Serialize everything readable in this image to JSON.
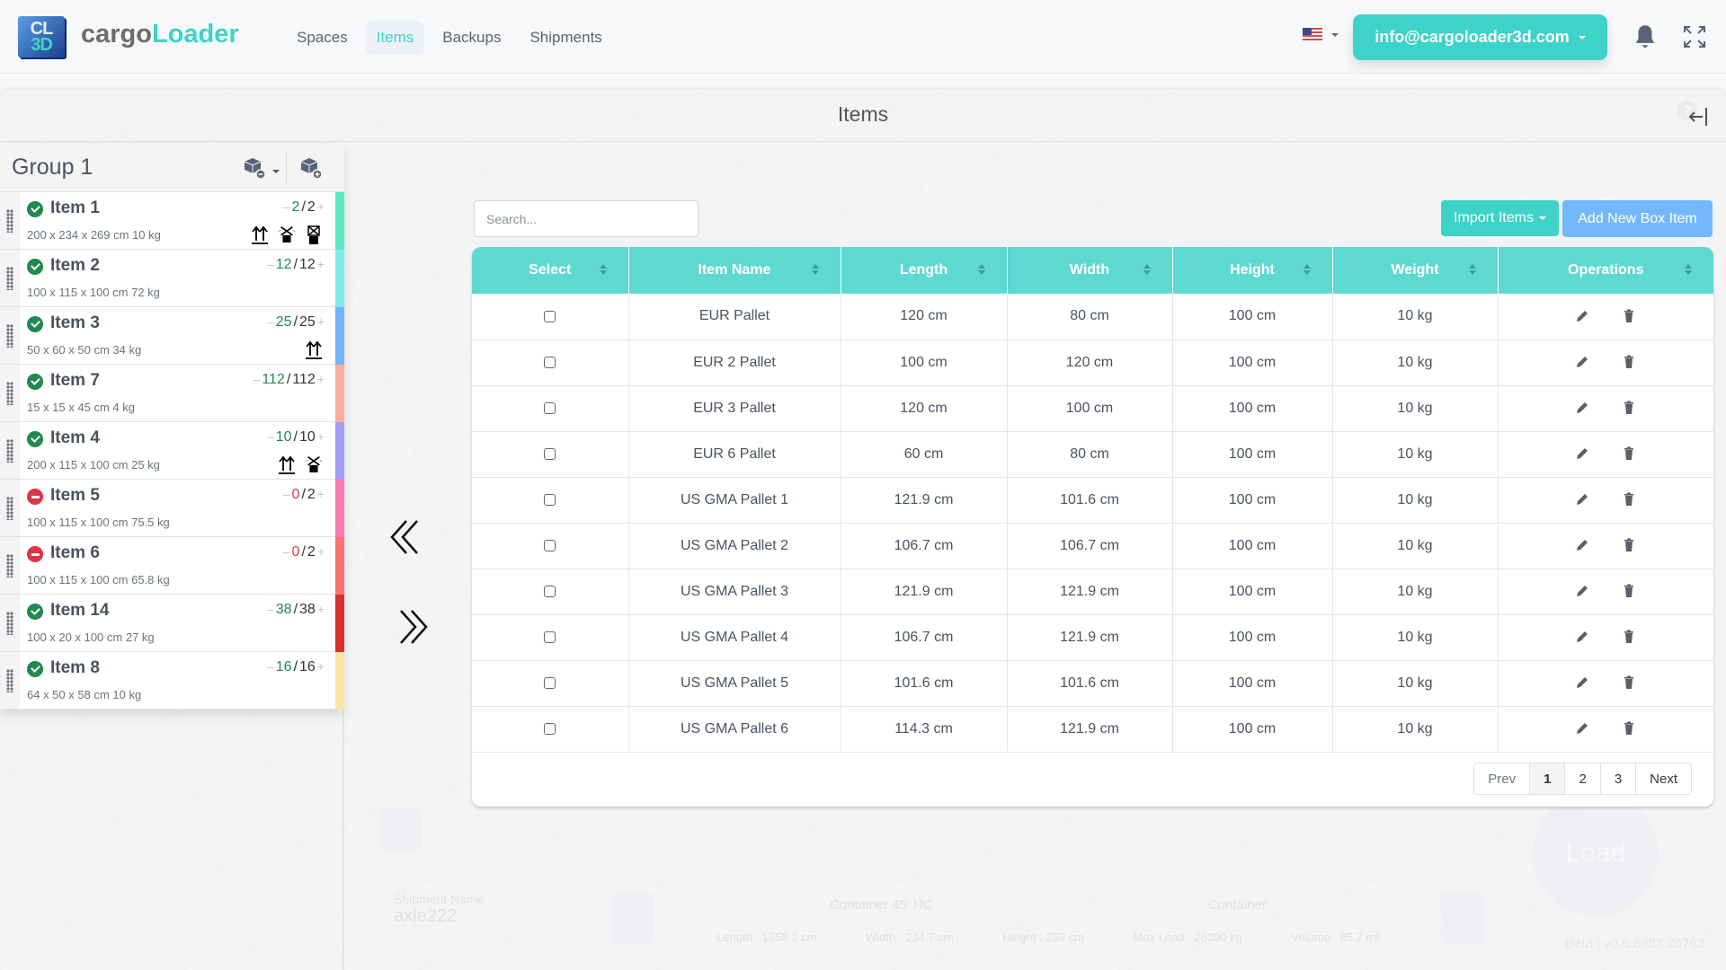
{
  "app": {
    "logo_line1": "CL",
    "logo_line2": "3D",
    "brand_part1": "cargo",
    "brand_part2": "Loader",
    "accent_color": "#3dd3c8"
  },
  "nav": {
    "items": [
      {
        "label": "Spaces",
        "active": false
      },
      {
        "label": "Items",
        "active": true
      },
      {
        "label": "Backups",
        "active": false
      },
      {
        "label": "Shipments",
        "active": false
      }
    ],
    "language_flag": "us-flag-icon",
    "account_email": "info@cargoloader3d.com",
    "notification_icon": "bell-icon",
    "fullscreen_icon": "fullscreen-icon"
  },
  "page": {
    "title": "Items",
    "help_glyph": "?",
    "collapse_icon": "collapse-left-icon"
  },
  "group": {
    "title": "Group 1",
    "remove_icon": "cube-minus-icon",
    "add_icon": "cube-plus-icon",
    "items": [
      {
        "name": "Item 1",
        "dims": "200 x 234 x 269 cm 10 kg",
        "loaded": "2",
        "total": "2",
        "status": "ok",
        "color": "#5ae8c4",
        "flags": [
          "this-side-up-icon",
          "no-stack-icon",
          "no-top-load-icon"
        ]
      },
      {
        "name": "Item 2",
        "dims": "100 x 115 x 100 cm 72 kg",
        "loaded": "12",
        "total": "12",
        "status": "ok",
        "color": "#7eeaea",
        "flags": []
      },
      {
        "name": "Item 3",
        "dims": "50 x 60 x 50 cm 34 kg",
        "loaded": "25",
        "total": "25",
        "status": "ok",
        "color": "#72b4fb",
        "flags": [
          "this-side-up-icon"
        ]
      },
      {
        "name": "Item 7",
        "dims": "15 x 15 x 45 cm 4 kg",
        "loaded": "112",
        "total": "112",
        "status": "ok",
        "color": "#f7b09c",
        "flags": []
      },
      {
        "name": "Item 4",
        "dims": "200 x 115 x 100 cm 25 kg",
        "loaded": "10",
        "total": "10",
        "status": "ok",
        "color": "#a59cf7",
        "flags": [
          "this-side-up-icon",
          "no-stack-icon"
        ]
      },
      {
        "name": "Item 5",
        "dims": "100 x 115 x 100 cm 75.5 kg",
        "loaded": "0",
        "total": "2",
        "status": "no",
        "color": "#fb7ab2",
        "flags": []
      },
      {
        "name": "Item 6",
        "dims": "100 x 115 x 100 cm 65.8 kg",
        "loaded": "0",
        "total": "2",
        "status": "no",
        "color": "#fb746f",
        "flags": []
      },
      {
        "name": "Item 14",
        "dims": "100 x 20 x 100 cm 27 kg",
        "loaded": "38",
        "total": "38",
        "status": "ok",
        "color": "#d93030",
        "flags": []
      },
      {
        "name": "Item 8",
        "dims": "64 x 50 x 58 cm 10 kg",
        "loaded": "16",
        "total": "16",
        "status": "ok",
        "color": "#fde4a0",
        "flags": []
      }
    ]
  },
  "transfer": {
    "left_icon": "double-chevron-left-icon",
    "right_icon": "double-chevron-right-icon"
  },
  "table": {
    "search_placeholder": "Search...",
    "import_label": "Import Items",
    "add_label": "Add New Box Item",
    "columns": [
      "Select",
      "Item Name",
      "Length",
      "Width",
      "Height",
      "Weight",
      "Operations"
    ],
    "rows": [
      {
        "name": "EUR Pallet",
        "length": "120 cm",
        "width": "80 cm",
        "height": "100 cm",
        "weight": "10 kg"
      },
      {
        "name": "EUR 2 Pallet",
        "length": "100 cm",
        "width": "120 cm",
        "height": "100 cm",
        "weight": "10 kg"
      },
      {
        "name": "EUR 3 Pallet",
        "length": "120 cm",
        "width": "100 cm",
        "height": "100 cm",
        "weight": "10 kg"
      },
      {
        "name": "EUR 6 Pallet",
        "length": "60 cm",
        "width": "80 cm",
        "height": "100 cm",
        "weight": "10 kg"
      },
      {
        "name": "US GMA Pallet 1",
        "length": "121.9 cm",
        "width": "101.6 cm",
        "height": "100 cm",
        "weight": "10 kg"
      },
      {
        "name": "US GMA Pallet 2",
        "length": "106.7 cm",
        "width": "106.7 cm",
        "height": "100 cm",
        "weight": "10 kg"
      },
      {
        "name": "US GMA Pallet 3",
        "length": "121.9 cm",
        "width": "121.9 cm",
        "height": "100 cm",
        "weight": "10 kg"
      },
      {
        "name": "US GMA Pallet 4",
        "length": "106.7 cm",
        "width": "121.9 cm",
        "height": "100 cm",
        "weight": "10 kg"
      },
      {
        "name": "US GMA Pallet 5",
        "length": "101.6 cm",
        "width": "101.6 cm",
        "height": "100 cm",
        "weight": "10 kg"
      },
      {
        "name": "US GMA Pallet 6",
        "length": "114.3 cm",
        "width": "121.9 cm",
        "height": "100 cm",
        "weight": "10 kg"
      }
    ],
    "pagination": {
      "prev": "Prev",
      "pages": [
        "1",
        "2",
        "3"
      ],
      "current": "1",
      "next": "Next"
    }
  },
  "background": {
    "load_label": "Load",
    "shipment_label": "Shipment Name",
    "shipment_value": "axle222",
    "container_title": "Container 45' HC",
    "container_type": "Container",
    "specs": [
      "Length : 1358.2 cm",
      "Width : 234.7 cm",
      "Height : 269 cm",
      "Max Load : 28390 kg",
      "Volume : 85.7 m³"
    ],
    "version": "Beta | v0.5.8983.26763"
  }
}
